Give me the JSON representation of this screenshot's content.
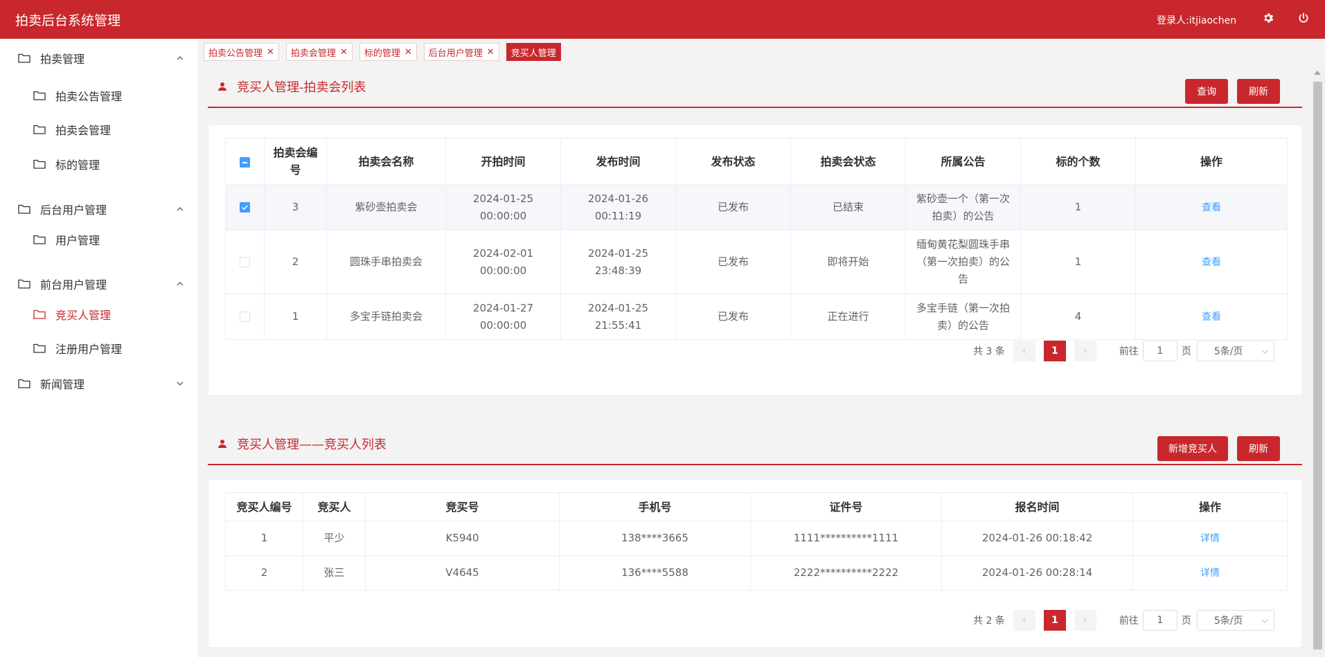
{
  "header": {
    "title": "拍卖后台系统管理",
    "login_user": "登录人:itjiaochen"
  },
  "sidebar": {
    "groups": [
      {
        "label": "拍卖管理",
        "expanded": true,
        "items": [
          {
            "label": "拍卖公告管理"
          },
          {
            "label": "拍卖会管理"
          },
          {
            "label": "标的管理"
          }
        ]
      },
      {
        "label": "后台用户管理",
        "expanded": true,
        "items": [
          {
            "label": "用户管理"
          }
        ]
      },
      {
        "label": "前台用户管理",
        "expanded": true,
        "items": [
          {
            "label": "竞买人管理",
            "active": true
          },
          {
            "label": "注册用户管理"
          }
        ]
      },
      {
        "label": "新闻管理",
        "expanded": false,
        "items": []
      }
    ]
  },
  "tabs": [
    {
      "label": "拍卖公告管理",
      "closable": true
    },
    {
      "label": "拍卖会管理",
      "closable": true
    },
    {
      "label": "标的管理",
      "closable": true
    },
    {
      "label": "后台用户管理",
      "closable": true
    },
    {
      "label": "竞买人管理",
      "closable": false,
      "active": true
    }
  ],
  "auction_section": {
    "title": "竞买人管理-拍卖会列表",
    "query_btn": "查询",
    "refresh_btn": "刷新",
    "columns": [
      "拍卖会编号",
      "拍卖会名称",
      "开拍时间",
      "发布时间",
      "发布状态",
      "拍卖会状态",
      "所属公告",
      "标的个数",
      "操作"
    ],
    "rows": [
      {
        "id": "3",
        "name": "紫砂壶拍卖会",
        "start": "2024-01-25 00:00:00",
        "publish": "2024-01-26 00:11:19",
        "pub_status": "已发布",
        "status": "已结束",
        "notice": "紫砂壶一个（第一次拍卖）的公告",
        "count": "1",
        "action": "查看",
        "checked": true
      },
      {
        "id": "2",
        "name": "圆珠手串拍卖会",
        "start": "2024-02-01 00:00:00",
        "publish": "2024-01-25 23:48:39",
        "pub_status": "已发布",
        "status": "即将开始",
        "notice": "缅甸黄花梨圆珠手串（第一次拍卖）的公告",
        "count": "1",
        "action": "查看",
        "checked": false
      },
      {
        "id": "1",
        "name": "多宝手链拍卖会",
        "start": "2024-01-27 00:00:00",
        "publish": "2024-01-25 21:55:41",
        "pub_status": "已发布",
        "status": "正在进行",
        "notice": "多宝手链（第一次拍卖）的公告",
        "count": "4",
        "action": "查看",
        "checked": false
      }
    ],
    "pager": {
      "total": "共 3 条",
      "page": "1",
      "goto_label": "前往",
      "goto_value": "1",
      "page_unit": "页",
      "page_size": "5条/页"
    }
  },
  "bidder_section": {
    "title": "竞买人管理——竞买人列表",
    "add_btn": "新增竞买人",
    "refresh_btn": "刷新",
    "columns": [
      "竞买人编号",
      "竞买人",
      "竞买号",
      "手机号",
      "证件号",
      "报名时间",
      "操作"
    ],
    "rows": [
      {
        "id": "1",
        "name": "平少",
        "bid_no": "K5940",
        "phone": "138****3665",
        "cert": "1111**********1111",
        "time": "2024-01-26 00:18:42",
        "action": "详情"
      },
      {
        "id": "2",
        "name": "张三",
        "bid_no": "V4645",
        "phone": "136****5588",
        "cert": "2222**********2222",
        "time": "2024-01-26 00:28:14",
        "action": "详情"
      }
    ],
    "pager": {
      "total": "共 2 条",
      "page": "1",
      "goto_label": "前往",
      "goto_value": "1",
      "page_unit": "页",
      "page_size": "5条/页"
    }
  }
}
